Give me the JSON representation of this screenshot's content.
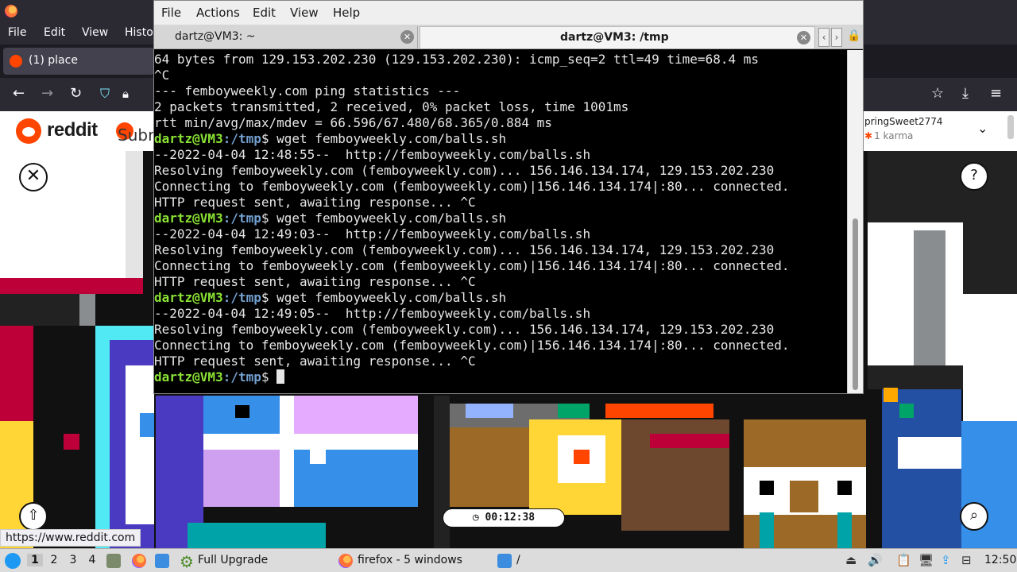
{
  "firefox": {
    "menu": [
      "File",
      "Edit",
      "View",
      "Histo"
    ],
    "tab_title": "(1) place",
    "nav": {
      "back": "←",
      "forward": "→",
      "reload": "↻",
      "star": "☆",
      "download": "⤓",
      "menu": "≡"
    },
    "reddit": {
      "wordmark": "reddit",
      "subreddit_partial": "Subr",
      "user_name": "pringSweet2774",
      "user_karma": "1 karma"
    },
    "overlays": {
      "close": "✕",
      "help": "?",
      "share": "⇧",
      "search": "⌕"
    },
    "timer": "00:12:38",
    "status_url": "https://www.reddit.com"
  },
  "terminal": {
    "menu": [
      "File",
      "Actions",
      "Edit",
      "View",
      "Help"
    ],
    "tabs": [
      {
        "label": "dartz@VM3: ~"
      },
      {
        "label": "dartz@VM3: /tmp"
      }
    ],
    "prompt_user": "dartz@VM3",
    "prompt_path": ":/tmp",
    "prompt_suffix": "$ ",
    "lines": [
      {
        "type": "out",
        "text": "64 bytes from 129.153.202.230 (129.153.202.230): icmp_seq=2 ttl=49 time=68.4 ms"
      },
      {
        "type": "out",
        "text": "^C"
      },
      {
        "type": "out",
        "text": "--- femboyweekly.com ping statistics ---"
      },
      {
        "type": "out",
        "text": "2 packets transmitted, 2 received, 0% packet loss, time 1001ms"
      },
      {
        "type": "out",
        "text": "rtt min/avg/max/mdev = 66.596/67.480/68.365/0.884 ms"
      },
      {
        "type": "cmd",
        "text": "wget femboyweekly.com/balls.sh"
      },
      {
        "type": "out",
        "text": "--2022-04-04 12:48:55--  http://femboyweekly.com/balls.sh"
      },
      {
        "type": "out",
        "text": "Resolving femboyweekly.com (femboyweekly.com)... 156.146.134.174, 129.153.202.230"
      },
      {
        "type": "out",
        "text": "Connecting to femboyweekly.com (femboyweekly.com)|156.146.134.174|:80... connected."
      },
      {
        "type": "out",
        "text": "HTTP request sent, awaiting response... ^C"
      },
      {
        "type": "cmd",
        "text": "wget femboyweekly.com/balls.sh"
      },
      {
        "type": "out",
        "text": "--2022-04-04 12:49:03--  http://femboyweekly.com/balls.sh"
      },
      {
        "type": "out",
        "text": "Resolving femboyweekly.com (femboyweekly.com)... 156.146.134.174, 129.153.202.230"
      },
      {
        "type": "out",
        "text": "Connecting to femboyweekly.com (femboyweekly.com)|156.146.134.174|:80... connected."
      },
      {
        "type": "out",
        "text": "HTTP request sent, awaiting response... ^C"
      },
      {
        "type": "cmd",
        "text": "wget femboyweekly.com/balls.sh"
      },
      {
        "type": "out",
        "text": "--2022-04-04 12:49:05--  http://femboyweekly.com/balls.sh"
      },
      {
        "type": "out",
        "text": "Resolving femboyweekly.com (femboyweekly.com)... 156.146.134.174, 129.153.202.230"
      },
      {
        "type": "out",
        "text": "Connecting to femboyweekly.com (femboyweekly.com)|156.146.134.174|:80... connected."
      },
      {
        "type": "out",
        "text": "HTTP request sent, awaiting response... ^C"
      },
      {
        "type": "cmd",
        "text": ""
      }
    ]
  },
  "taskbar": {
    "workspaces": [
      "1",
      "2",
      "3",
      "4"
    ],
    "task_upgrade": "Full Upgrade",
    "task_firefox": "firefox - 5 windows",
    "task_folder": "/",
    "clock": "12:50"
  },
  "icons": {
    "volume": "🔊",
    "clipboard": "📋",
    "display": "🖥",
    "lock": "🔒"
  }
}
